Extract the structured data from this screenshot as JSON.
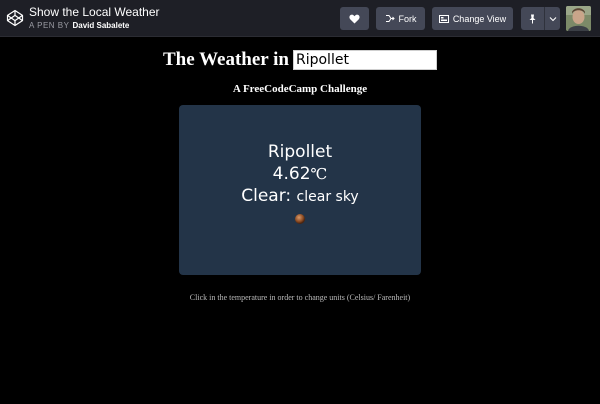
{
  "header": {
    "title": "Show the Local Weather",
    "byline_prefix": "A PEN BY",
    "author": "David Sabalete",
    "buttons": {
      "fork": "Fork",
      "change_view": "Change View"
    },
    "icons": [
      "codepen-logo-icon",
      "heart-icon",
      "fork-icon",
      "change-view-icon",
      "pin-icon",
      "chevron-down-icon"
    ]
  },
  "page": {
    "heading": "The Weather in",
    "city_input_value": "Ripollet",
    "subtitle": "A FreeCodeCamp Challenge",
    "hint": "Click in the temperature in order to change units (Celsius/ Farenheit)"
  },
  "weather": {
    "city": "Ripollet",
    "temperature": "4.62",
    "unit": "℃",
    "condition": "Clear:",
    "description": "clear sky",
    "icon": "weather-icon"
  },
  "colors": {
    "background": "#000000",
    "topbar": "#1e1f26",
    "button": "#444857",
    "card": "#233448"
  }
}
